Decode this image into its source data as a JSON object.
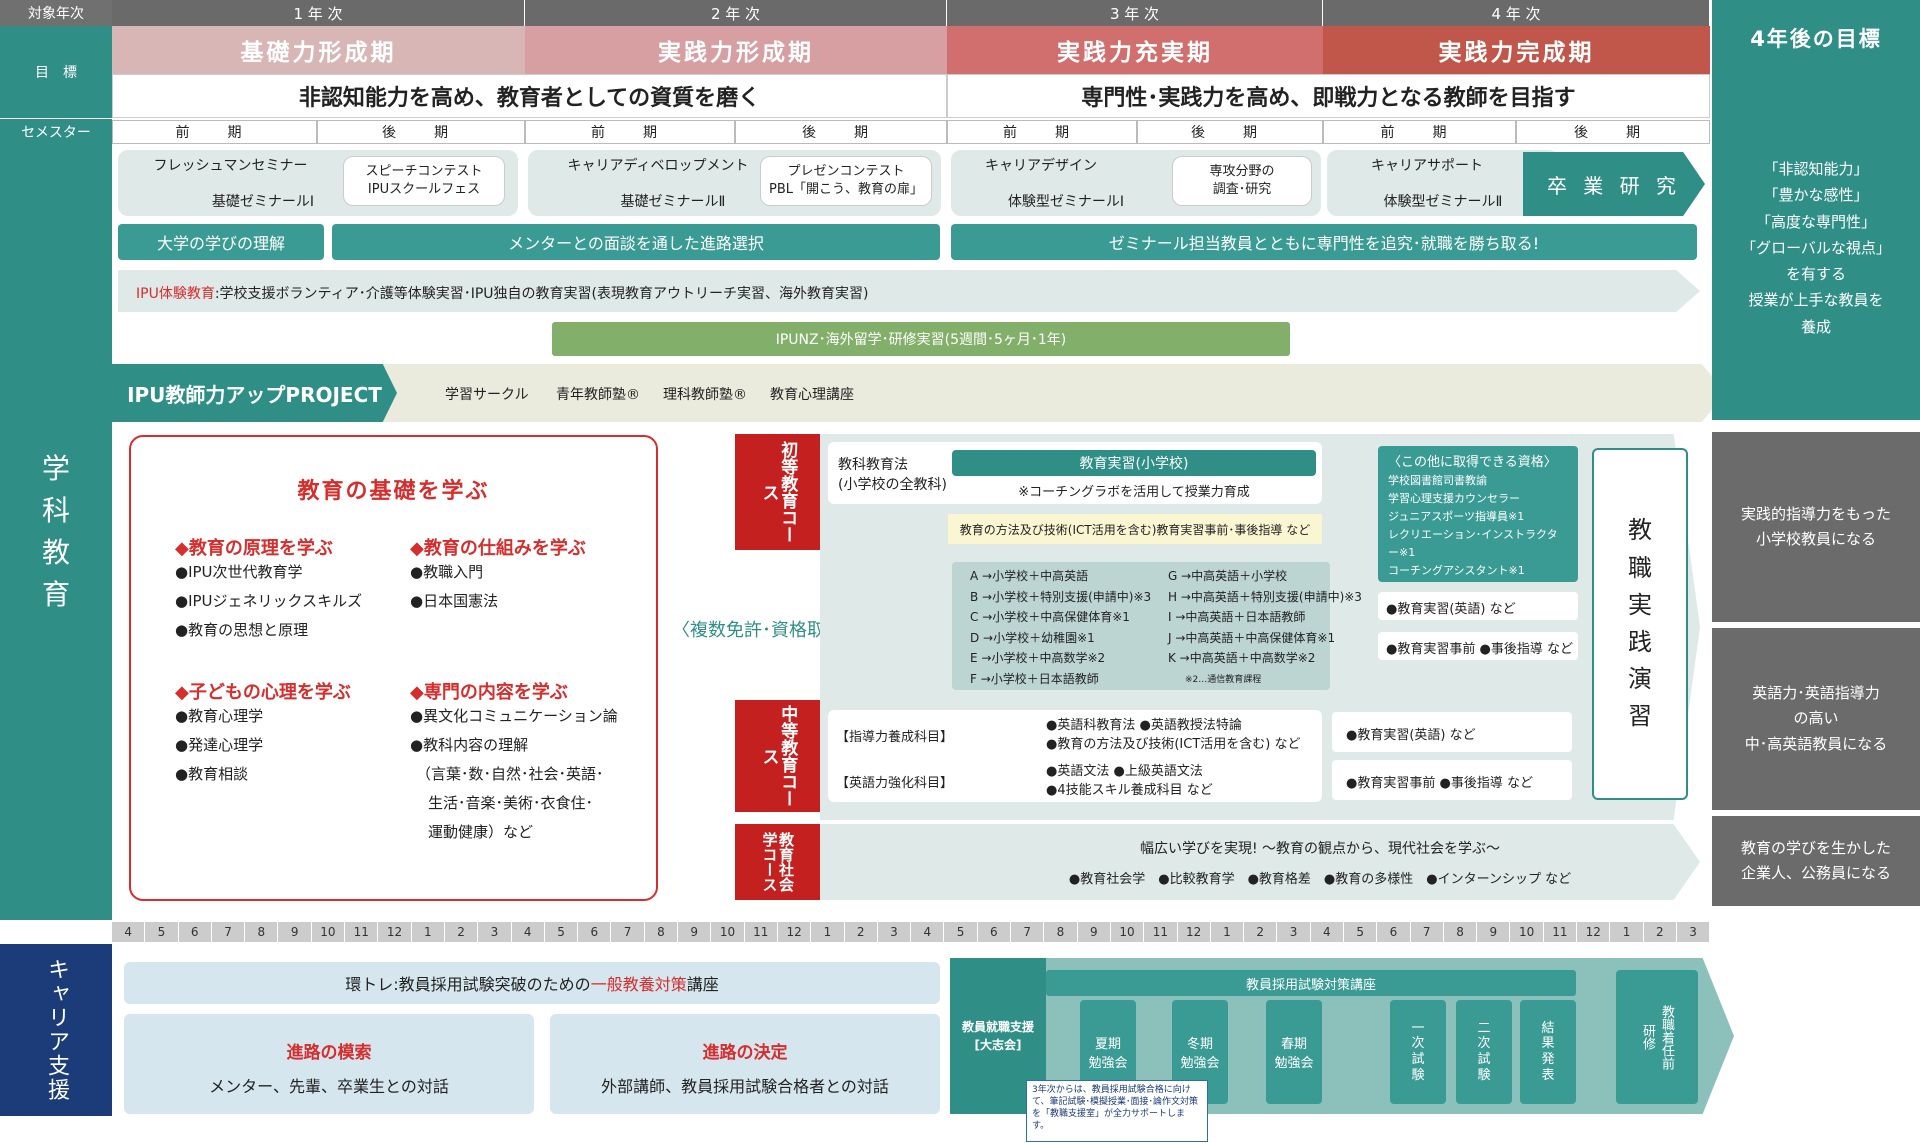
{
  "header": {
    "target_year": "対象年次",
    "years": [
      "1 年 次",
      "2 年 次",
      "3 年 次",
      "4 年 次"
    ],
    "goal_label": "目　標",
    "semester_label": "セメスター",
    "phases": [
      "基礎力形成期",
      "実践力形成期",
      "実践力充実期",
      "実践力完成期"
    ],
    "goal4": "4年後の目標",
    "goal_line1": "非認知能力を高め、教育者としての資質を磨く",
    "goal_line2": "専門性･実践力を高め、即戦力となる教師を目指す",
    "zenki": "前　期",
    "kouki": "後　期"
  },
  "side": {
    "gakka": "学\n科\n教\n育",
    "career": "キャリア支援"
  },
  "seminars": {
    "y1a": "フレッシュマンセミナー",
    "y1b": "基礎ゼミナールⅠ",
    "y1c1": "スピーチコンテスト",
    "y1c2": "IPUスクールフェス",
    "y2a": "キャリアディベロップメント",
    "y2b": "基礎ゼミナールⅡ",
    "y2c1": "プレゼンコンテスト",
    "y2c2": "PBL「開こう、教育の扉」",
    "y3a": "キャリアデザイン",
    "y3b": "体験型ゼミナールⅠ",
    "y3c1": "専攻分野の",
    "y3c2": "調査･研究",
    "y4a": "キャリアサポート",
    "y4b": "体験型ゼミナールⅡ",
    "sotsugyo": "卒 業 研 究"
  },
  "bars": {
    "b1": "大学の学びの理解",
    "b2": "メンターとの面談を通した進路選択",
    "b3": "ゼミナール担当教員とともに専門性を追究･就職を勝ち取る!"
  },
  "taiken": {
    "label": "IPU体験教育",
    "text": ":学校支援ボランティア･介護等体験実習･IPU独自の教育実習(表現教育アウトリーチ実習、海外教育実習)"
  },
  "ipunz": "IPUNZ･海外留学･研修実習(5週間･5ヶ月･1年)",
  "project": {
    "title": "IPU教師力アップPROJECT",
    "items": [
      "学習サークル",
      "青年教師塾®",
      "理科教師塾®",
      "教育心理講座"
    ]
  },
  "goals_right": {
    "g1": "「非認知能力」\n「豊かな感性」\n「高度な専門性」\n「グローバルな視点」\nを有する\n授業が上手な教員を\n養成",
    "g2": "実践的指導力をもった\n小学校教員になる",
    "g3": "英語力･英語指導力\nの高い\n中･高英語教員になる",
    "g4": "教育の学びを生かした\n企業人、公務員になる"
  },
  "kiso": {
    "title": "教育の基礎を学ぶ",
    "h1": "◆教育の原理を学ぶ",
    "l1": [
      "●IPU次世代教育学",
      "●IPUジェネリックスキルズ",
      "●教育の思想と原理"
    ],
    "h2": "◆教育の仕組みを学ぶ",
    "l2": [
      "●教職入門",
      "●日本国憲法"
    ],
    "h3": "◆子どもの心理を学ぶ",
    "l3": [
      "●教育心理学",
      "●発達心理学",
      "●教育相談"
    ],
    "h4": "◆専門の内容を学ぶ",
    "l4": [
      "●異文化コミュニケーション論",
      "●教科内容の理解",
      "（言葉･数･自然･社会･英語･",
      "生活･音楽･美術･衣食住･",
      "運動健康）など"
    ]
  },
  "fukusu": "〈複数免許･資格取得パターン〉",
  "shoto": {
    "name": "初等教育コース",
    "k1": "教科教育法",
    "k2": "(小学校の全教科)",
    "jisshu": "教育実習(小学校)",
    "coach": "※コーチングラボを活用して授業力育成",
    "houhou": "教育の方法及び技術(ICT活用を含む)教育実習事前･事後指導 など"
  },
  "patterns": {
    "left": [
      "A →小学校＋中高英語",
      "B →小学校＋特別支援(申請中)※3",
      "C →小学校＋中高保健体育※1",
      "D →小学校＋幼稚園※1",
      "E →小学校＋中高数学※2",
      "F →小学校＋日本語教師"
    ],
    "right": [
      "G →中高英語＋小学校",
      "H →中高英語＋特別支援(申請中)※3",
      "I →中高英語＋日本語教師",
      "J →中高英語＋中高保健体育※1",
      "K →中高英語＋中高数学※2"
    ],
    "note": "※2…通信教育課程"
  },
  "other": {
    "title": "〈この他に取得できる資格〉",
    "items": [
      "学校図書館司書教諭",
      "学習心理支援カウンセラー",
      "ジュニアスポーツ指導員※1",
      "レクリエーション･インストラクター※1",
      "コーチングアシスタント※1"
    ],
    "e1": "●教育実習(英語) など",
    "e2": "●教育実習事前 ●事後指導 など"
  },
  "kyoshoku": "教\n職\n実\n践\n演\n習",
  "chuto": {
    "name": "中等教育コース",
    "s1": "【指導力養成科目】",
    "s1a": "●英語科教育法 ●英語教授法特論",
    "s1b": "●教育の方法及び技術(ICT活用を含む) など",
    "s2": "【英語力強化科目】",
    "s2a": "●英語文法 ●上級英語文法",
    "s2b": "●4技能スキル養成科目 など",
    "r1": "●教育実習(英語) など",
    "r2": "●教育実習事前 ●事後指導 など"
  },
  "shakai": {
    "name": "教育社会学コース",
    "t1": "幅広い学びを実現! ～教育の観点から、現代社会を学ぶ～",
    "t2": "●教育社会学　●比較教育学　●教育格差　●教育の多様性　●インターンシップ など"
  },
  "months": [
    "4",
    "5",
    "6",
    "7",
    "8",
    "9",
    "10",
    "11",
    "12",
    "1",
    "2",
    "3"
  ],
  "career": {
    "kantore1": "環トレ:教員採用試験突破のための",
    "kantore2": "一般教養対策",
    "kantore3": "講座",
    "mosaku": "進路の模索",
    "mosaku_t": "メンター、先輩、卒業生との対話",
    "kettei": "進路の決定",
    "kettei_t": "外部講師、教員採用試験合格者との対話",
    "taisaku": "教員採用試験対策講座",
    "shien": "教員就職支援\n[大志会]",
    "items": [
      "夏期\n勉強会",
      "冬期\n勉強会",
      "春期\n勉強会",
      "一\n次\n試\n験",
      "二\n次\n試\n験",
      "結\n果\n発\n表",
      "教職着任前\n研修"
    ],
    "note": "3年次からは、教員採用試験合格に向けて、筆記試験･模擬授業･面接･論作文対策を「教職支援室」が全力サポートします。"
  }
}
